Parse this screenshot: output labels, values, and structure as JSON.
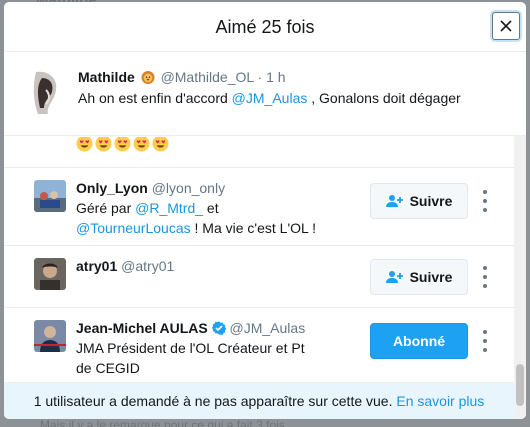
{
  "background": {
    "top_text": "Mathilde",
    "bottom_text": "Mais il y a le remarque pour ce qui a fait 3 fois"
  },
  "modal": {
    "title": "Aimé 25 fois",
    "close_icon": "close-icon"
  },
  "tweet": {
    "name": "Mathilde",
    "handle": "@Mathilde_OL",
    "separator": "·",
    "time": "1 h",
    "text_before": "Ah on est enfin d'accord ",
    "mention": "@JM_Aulas",
    "text_after": " , Gonalons doit dégager"
  },
  "users": [
    {
      "name": "Only_Lyon",
      "handle": "@lyon_only",
      "bio_prefix": "Géré par ",
      "bio_mention1": "@R_Mtrd_",
      "bio_mid": " et",
      "bio_mention2": "@TourneurLoucas",
      "bio_suffix": " ! Ma vie c'est L'OL !",
      "button": "Suivre"
    },
    {
      "name": "atry01",
      "handle": "@atry01",
      "button": "Suivre"
    },
    {
      "name": "Jean-Michel AULAS",
      "handle": "@JM_Aulas",
      "bio_line1": "JMA Président de l'OL Créateur et Pt",
      "bio_line2": "de CEGID",
      "button": "Abonné"
    }
  ],
  "footer": {
    "text": "1 utilisateur a demandé à ne pas apparaître sur cette vue. ",
    "link": "En savoir plus"
  },
  "colors": {
    "accent": "#1da1f2",
    "link": "#1b95e0",
    "footer_bg": "#e8f5fd"
  }
}
